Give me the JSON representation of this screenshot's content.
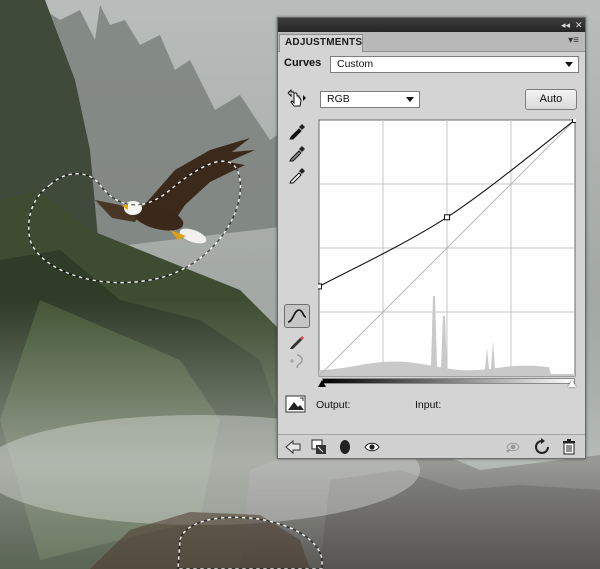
{
  "panel": {
    "tab_label": "ADJUSTMENTS",
    "collapse_glyph": "◂◂",
    "close_glyph": "✕",
    "menu_glyph": "▾≡"
  },
  "curves": {
    "label": "Curves",
    "preset_value": "Custom",
    "channel_value": "RGB",
    "auto_label": "Auto",
    "output_label": "Output:",
    "input_label": "Input:",
    "curve_points": [
      [
        0,
        35
      ],
      [
        50,
        62
      ],
      [
        100,
        100
      ]
    ],
    "grid_divisions": 4
  },
  "tools": [
    "on-image-adjust-icon",
    "black-point-eyedropper-icon",
    "gray-point-eyedropper-icon",
    "white-point-eyedropper-icon",
    "curve-point-mode-icon",
    "pencil-draw-icon",
    "smooth-curve-icon",
    "clipping-warning-icon"
  ],
  "bottom_icons": [
    "return-to-list-icon",
    "clip-to-layer-icon",
    "layer-mask-icon",
    "visibility-eye-icon",
    "view-previous-state-icon",
    "reset-icon",
    "delete-icon"
  ],
  "colors": {
    "panel_bg": "#d4d4d4",
    "titlebar": "#2e2e2e",
    "selection_outline": "#ffffff"
  }
}
